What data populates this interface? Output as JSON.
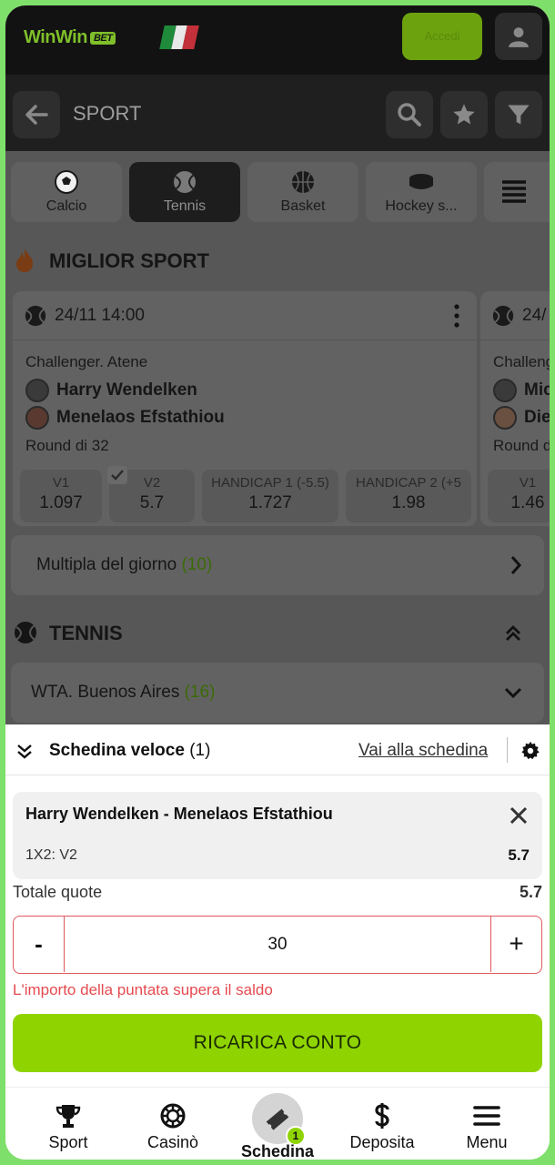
{
  "header": {
    "logo_text": "WinWin",
    "logo_badge": "BET",
    "login_label": "Accedi",
    "flag_colors": [
      "#1e8a3a",
      "#e8e8e8",
      "#c3303a"
    ]
  },
  "nav": {
    "title": "SPORT",
    "back_icon": "arrow-left-icon",
    "icons": [
      "search-icon",
      "star-icon",
      "filter-icon"
    ]
  },
  "sport_tabs": [
    {
      "label": "Calcio",
      "icon": "soccer-ball-icon",
      "active": false
    },
    {
      "label": "Tennis",
      "icon": "tennis-ball-icon",
      "active": true
    },
    {
      "label": "Basket",
      "icon": "basketball-icon",
      "active": false
    },
    {
      "label": "Hockey s...",
      "icon": "hockey-puck-icon",
      "active": false
    }
  ],
  "top_sport": {
    "title": "MIGLIOR SPORT",
    "card": {
      "datetime": "24/11 14:00",
      "tournament": "Challenger. Atene",
      "player1": "Harry Wendelken",
      "player2": "Menelaos Efstathiou",
      "round": "Round di 32",
      "odds": [
        {
          "label": "V1",
          "value": "1.097"
        },
        {
          "label": "V2",
          "value": "5.7"
        },
        {
          "label": "HANDICAP 1 (-5.5)",
          "value": "1.727"
        },
        {
          "label": "HANDICAP 2 (+5",
          "value": "1.98"
        }
      ]
    },
    "card2": {
      "datetime": "24/",
      "tournament": "Challeng",
      "player1": "Mic",
      "player2": "Die",
      "round": "Round d",
      "odd_label": "V1",
      "odd_value": "1.46"
    }
  },
  "daily_multi": {
    "label": "Multipla del giorno",
    "count": "(10)"
  },
  "tennis": {
    "title": "TENNIS",
    "league": "WTA. Buenos Aires",
    "league_count": "(16)"
  },
  "betslip": {
    "title": "Schedina veloce",
    "count": "(1)",
    "go_link": "Vai alla schedina",
    "match": "Harry Wendelken - Menelaos Efstathiou",
    "market": "1X2: V2",
    "odd": "5.7",
    "total_label": "Totale quote",
    "total_value": "5.7",
    "minus": "-",
    "plus": "+",
    "stake": "30",
    "error": "L'importo della puntata supera il saldo",
    "recharge": "RICARICA CONTO"
  },
  "bottom_nav": [
    {
      "label": "Sport",
      "icon": "trophy-icon"
    },
    {
      "label": "Casinò",
      "icon": "casino-chip-icon"
    },
    {
      "label": "Schedina",
      "icon": "ticket-icon",
      "badge": "1"
    },
    {
      "label": "Deposita",
      "icon": "dollar-icon"
    },
    {
      "label": "Menu",
      "icon": "hamburger-menu-icon"
    }
  ]
}
